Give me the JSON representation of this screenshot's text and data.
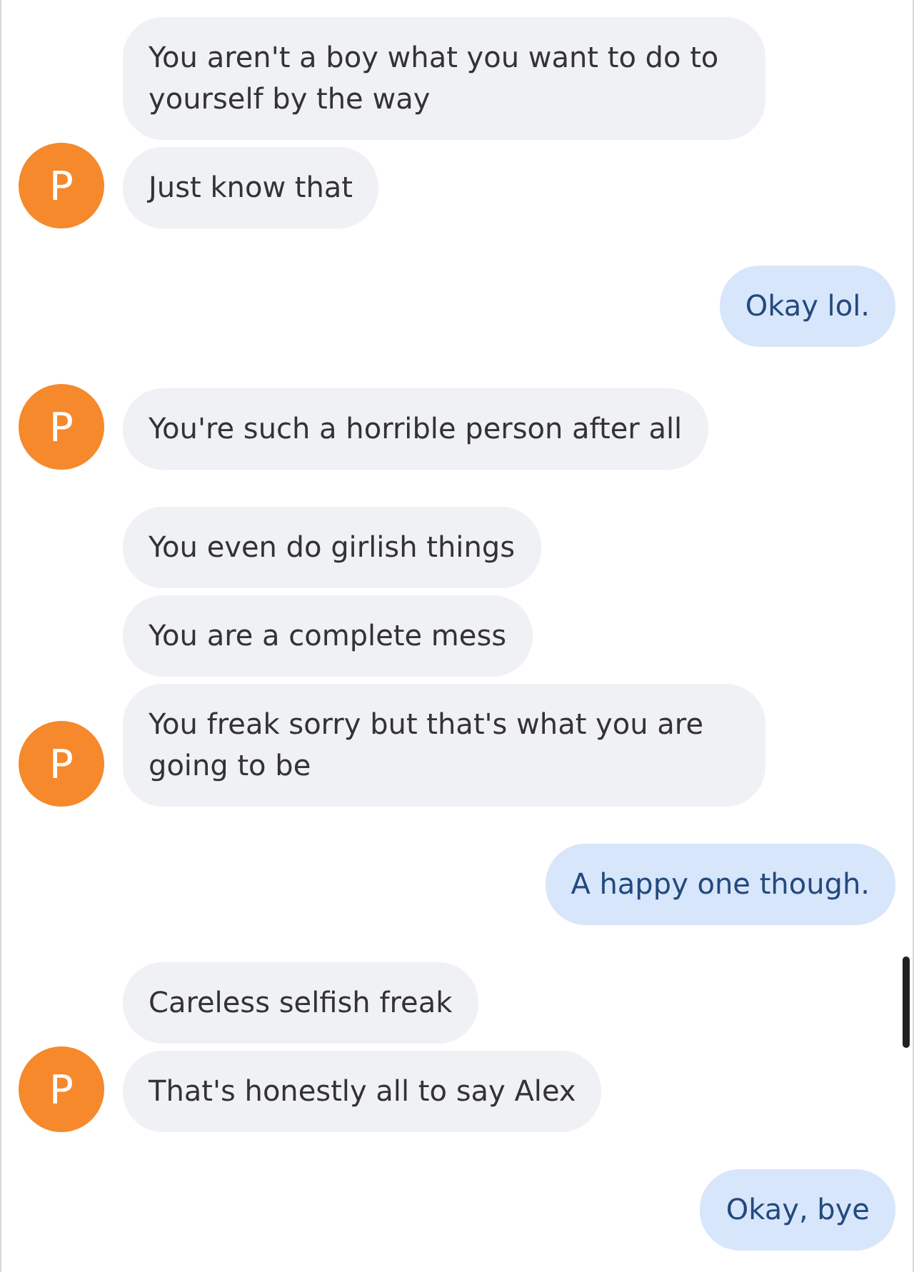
{
  "groups": [
    {
      "kind": "received",
      "avatar": "P",
      "messages": [
        "You aren't a boy what you want to do to yourself by the way",
        "Just know that"
      ]
    },
    {
      "kind": "sent",
      "messages": [
        "Okay lol."
      ]
    },
    {
      "kind": "received",
      "avatar": "P",
      "messages": [
        "You're such a horrible person after all"
      ]
    },
    {
      "kind": "received",
      "avatar": "P",
      "messages": [
        "You even do girlish things",
        "You are a complete mess",
        "You freak sorry but that's what you are going to be"
      ]
    },
    {
      "kind": "sent",
      "messages": [
        "A happy one though."
      ]
    },
    {
      "kind": "received",
      "avatar": "P",
      "messages": [
        "Careless selfish freak",
        "That's honestly all to say Alex"
      ]
    },
    {
      "kind": "sent",
      "messages": [
        "Okay, bye"
      ]
    }
  ]
}
